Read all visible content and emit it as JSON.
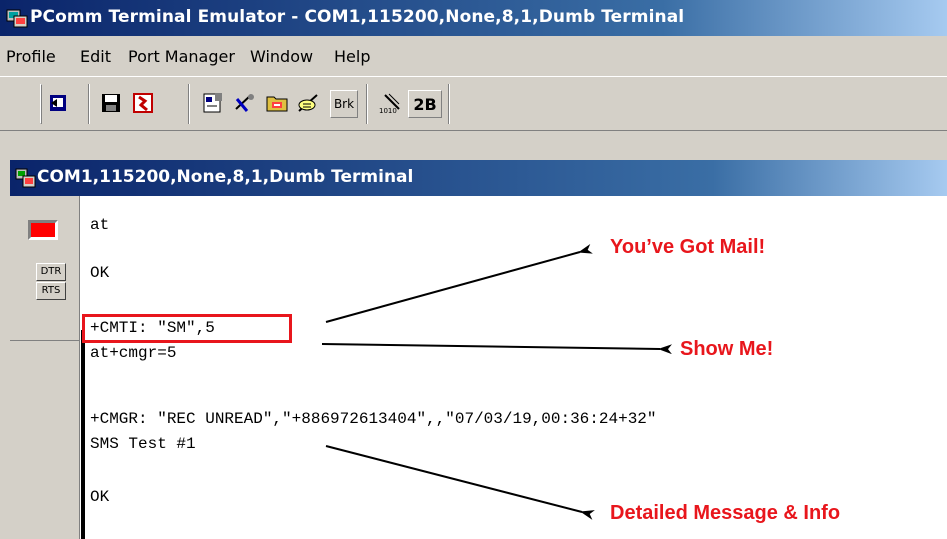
{
  "window": {
    "title": "PComm Terminal Emulator - COM1,115200,None,8,1,Dumb Terminal"
  },
  "menu": {
    "items": [
      "Profile",
      "Edit",
      "Port Manager",
      "Window",
      "Help"
    ]
  },
  "toolbar": {
    "buttons": [
      {
        "icon": "open-session-icon"
      },
      {
        "icon": "save-icon"
      },
      {
        "icon": "exit-icon"
      },
      {
        "icon": "properties-icon"
      },
      {
        "icon": "transfer-icon"
      },
      {
        "icon": "capture-icon"
      },
      {
        "icon": "script-icon"
      },
      {
        "label": "Brk"
      },
      {
        "icon": "signal-icon"
      },
      {
        "label": "2B"
      }
    ]
  },
  "session": {
    "title": "COM1,115200,None,8,1,Dumb Terminal",
    "signals": [
      "DTR",
      "RTS"
    ],
    "led_color": "#ff0000"
  },
  "terminal": {
    "lines": [
      "at",
      "OK",
      "+CMTI: \"SM\",5",
      "at+cmgr=5",
      "+CMGR: \"REC UNREAD\",\"+886972613404\",,\"07/03/19,00:36:24+32\"",
      "SMS Test #1",
      "OK"
    ]
  },
  "annotations": {
    "mail": "You’ve Got Mail!",
    "show": "Show Me!",
    "detail": "Detailed Message & Info",
    "color": "#e8161c"
  }
}
